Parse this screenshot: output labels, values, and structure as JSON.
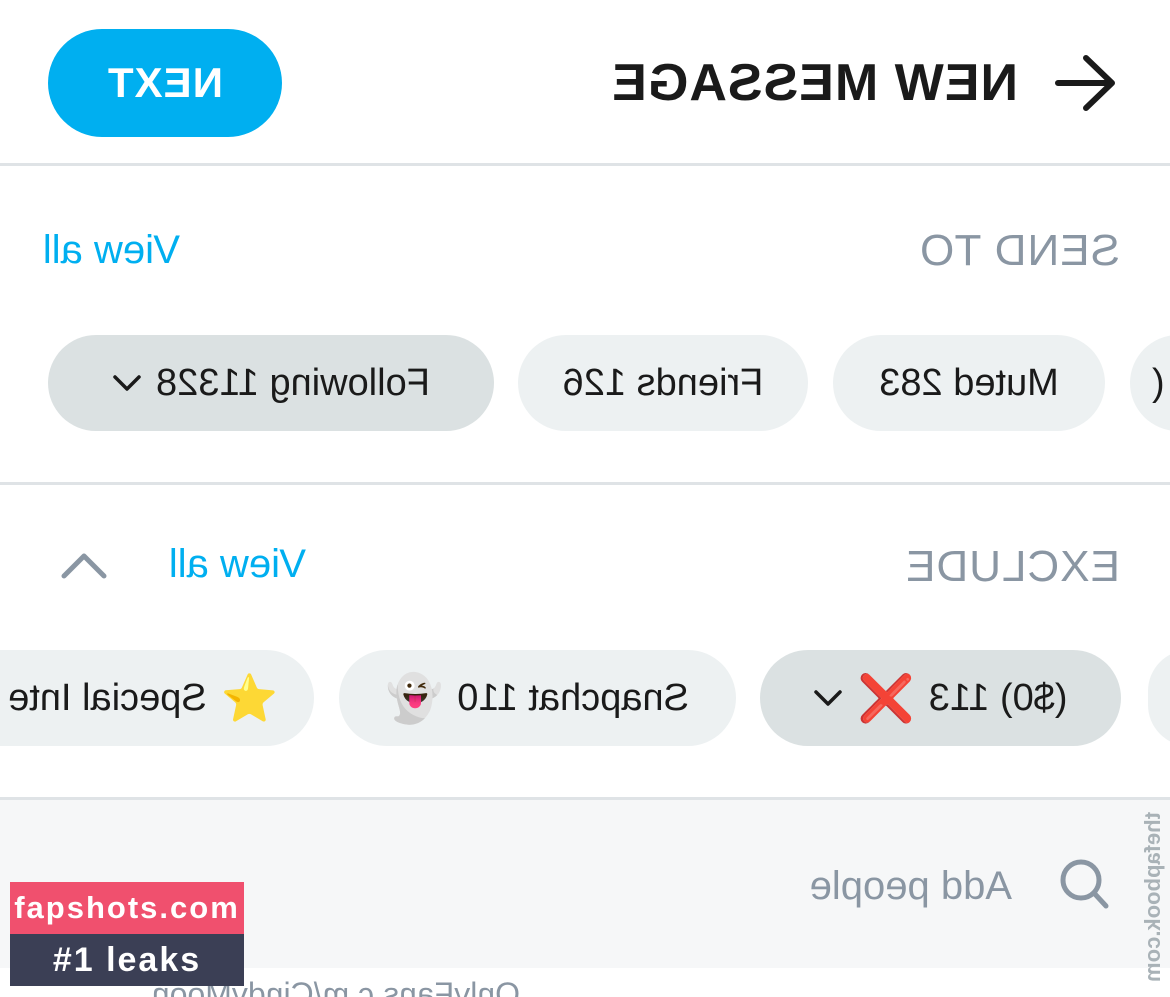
{
  "header": {
    "title": "NEW MESSAGE",
    "next_label": "NEXT",
    "back_icon": "arrow-left-icon"
  },
  "send_to": {
    "label": "SEND TO",
    "view_all": "View all",
    "chips": [
      {
        "label": "Following 11328",
        "has_dropdown": true,
        "selected": true
      },
      {
        "label": "Friends 126"
      },
      {
        "label": "Muted 283"
      },
      {
        "label": "("
      }
    ]
  },
  "exclude": {
    "label": "EXCLUDE",
    "view_all": "View all",
    "collapse_icon": "chevron-up-icon",
    "chips": [
      {
        "label": "($0) 113",
        "emoji": "❌",
        "has_dropdown": true,
        "selected": true
      },
      {
        "label": "Snapchat 110",
        "emoji": "👻"
      },
      {
        "label": "Special Inte",
        "emoji": "⭐"
      }
    ]
  },
  "search": {
    "placeholder": "Add people",
    "icon": "search-icon"
  },
  "peek_text": "OnlyFans c m/CindyMoon",
  "watermark": {
    "site": "fapshots.com",
    "tag": "#1 leaks",
    "side": "thefapbook.com"
  },
  "colors": {
    "accent": "#00aff0",
    "muted_text": "#8a96a3",
    "chip_bg": "#edf1f2",
    "chip_selected_bg": "#dbe1e2"
  }
}
